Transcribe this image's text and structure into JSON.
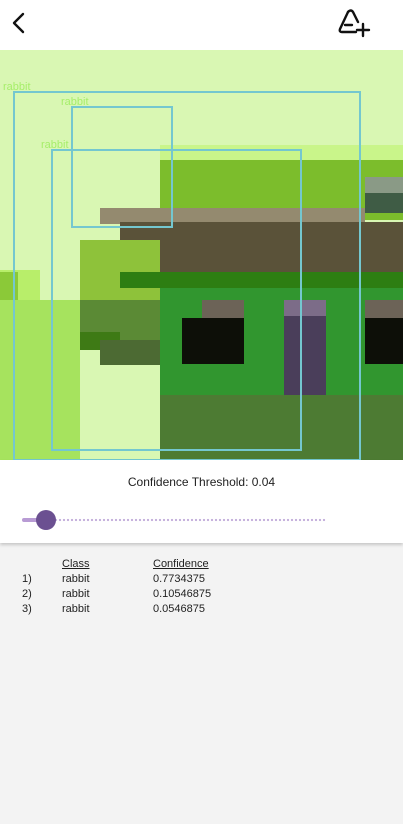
{
  "header": {
    "back_icon": "chevron-left-icon",
    "add_icon": "add-triangle-icon"
  },
  "detections": [
    {
      "label": "rabbit"
    },
    {
      "label": "rabbit"
    },
    {
      "label": "rabbit"
    }
  ],
  "threshold": {
    "label": "Confidence Threshold: 0.04",
    "value": 0.04
  },
  "results": {
    "headers": {
      "class": "Class",
      "confidence": "Confidence"
    },
    "rows": [
      {
        "index": "1)",
        "class": "rabbit",
        "confidence": "0.7734375"
      },
      {
        "index": "2)",
        "class": "rabbit",
        "confidence": "0.10546875"
      },
      {
        "index": "3)",
        "class": "rabbit",
        "confidence": "0.0546875"
      }
    ]
  },
  "colors": {
    "box": "#74c7cf",
    "box_label": "#a6ee6a",
    "slider_thumb": "#6b5091",
    "slider_track": "#c7b3dd"
  }
}
